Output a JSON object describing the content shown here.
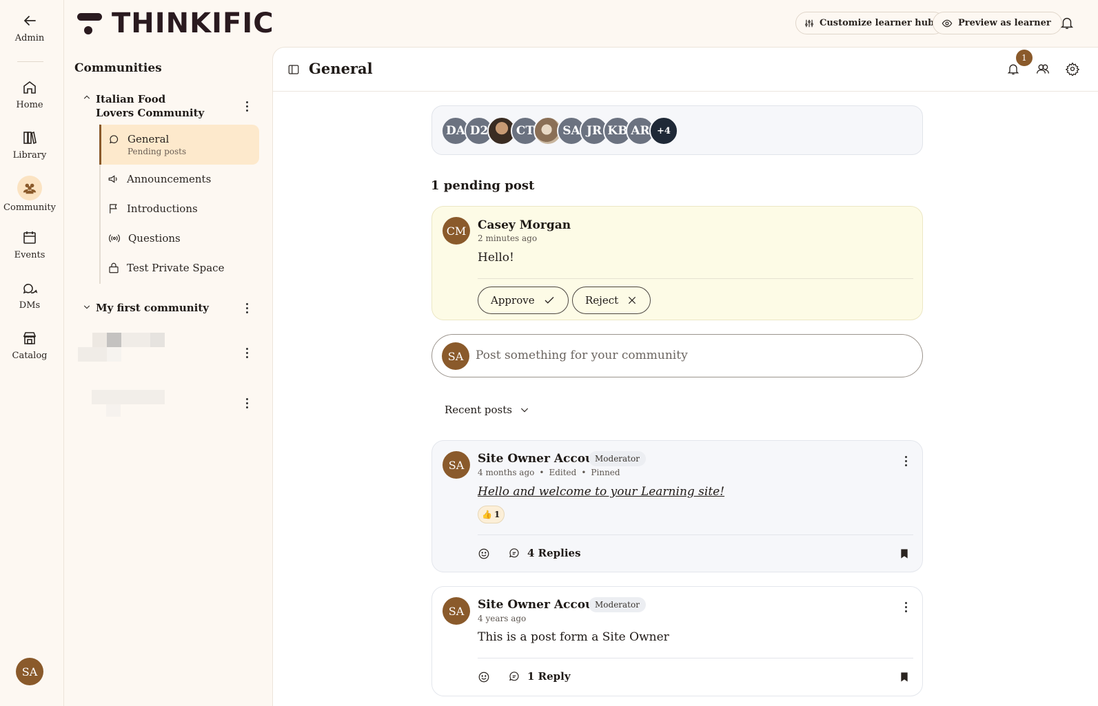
{
  "rail": {
    "admin": "Admin",
    "home": "Home",
    "library": "Library",
    "community": "Community",
    "events": "Events",
    "dms": "DMs",
    "catalog": "Catalog",
    "avatar": "SA"
  },
  "brand": {
    "name": "THINKIFIC"
  },
  "topbar": {
    "customize": "Customize learner hub",
    "preview": "Preview as learner"
  },
  "sidebar": {
    "title": "Communities",
    "community1": "Italian Food Lovers Community",
    "spaces": [
      {
        "label": "General",
        "sub": "Pending posts"
      },
      {
        "label": "Announcements"
      },
      {
        "label": "Introductions"
      },
      {
        "label": "Questions"
      },
      {
        "label": "Test Private Space"
      }
    ],
    "community2": "My first community"
  },
  "header": {
    "title": "General",
    "notif_count": "1"
  },
  "members": {
    "avatars": [
      "DA",
      "D2",
      "",
      "CT",
      "",
      "SA",
      "JR",
      "KB",
      "AR"
    ],
    "more": "+4"
  },
  "pending": {
    "title": "1 pending post",
    "initials": "CM",
    "author": "Casey Morgan",
    "time": "2 minutes ago",
    "body": "Hello!",
    "approve": "Approve",
    "reject": "Reject"
  },
  "composer": {
    "initials": "SA",
    "placeholder": "Post something for your community"
  },
  "sort": {
    "label": "Recent posts"
  },
  "posts": [
    {
      "initials": "SA",
      "author": "Site Owner Account",
      "role": "Moderator",
      "time": "4 months ago",
      "edited": "Edited",
      "pinned": "Pinned",
      "body": "Hello and welcome to your Learning site!",
      "reaction_emoji": "👍",
      "reaction_count": "1",
      "replies": "4 Replies"
    },
    {
      "initials": "SA",
      "author": "Site Owner Account",
      "role": "Moderator",
      "time": "4 years ago",
      "body": "This is a post form a Site Owner",
      "replies": "1 Reply"
    }
  ],
  "colors": {
    "brand_brown": "#8a5a2b",
    "active_space": "#fde9cc",
    "pending_bg": "#fdfbe6"
  }
}
